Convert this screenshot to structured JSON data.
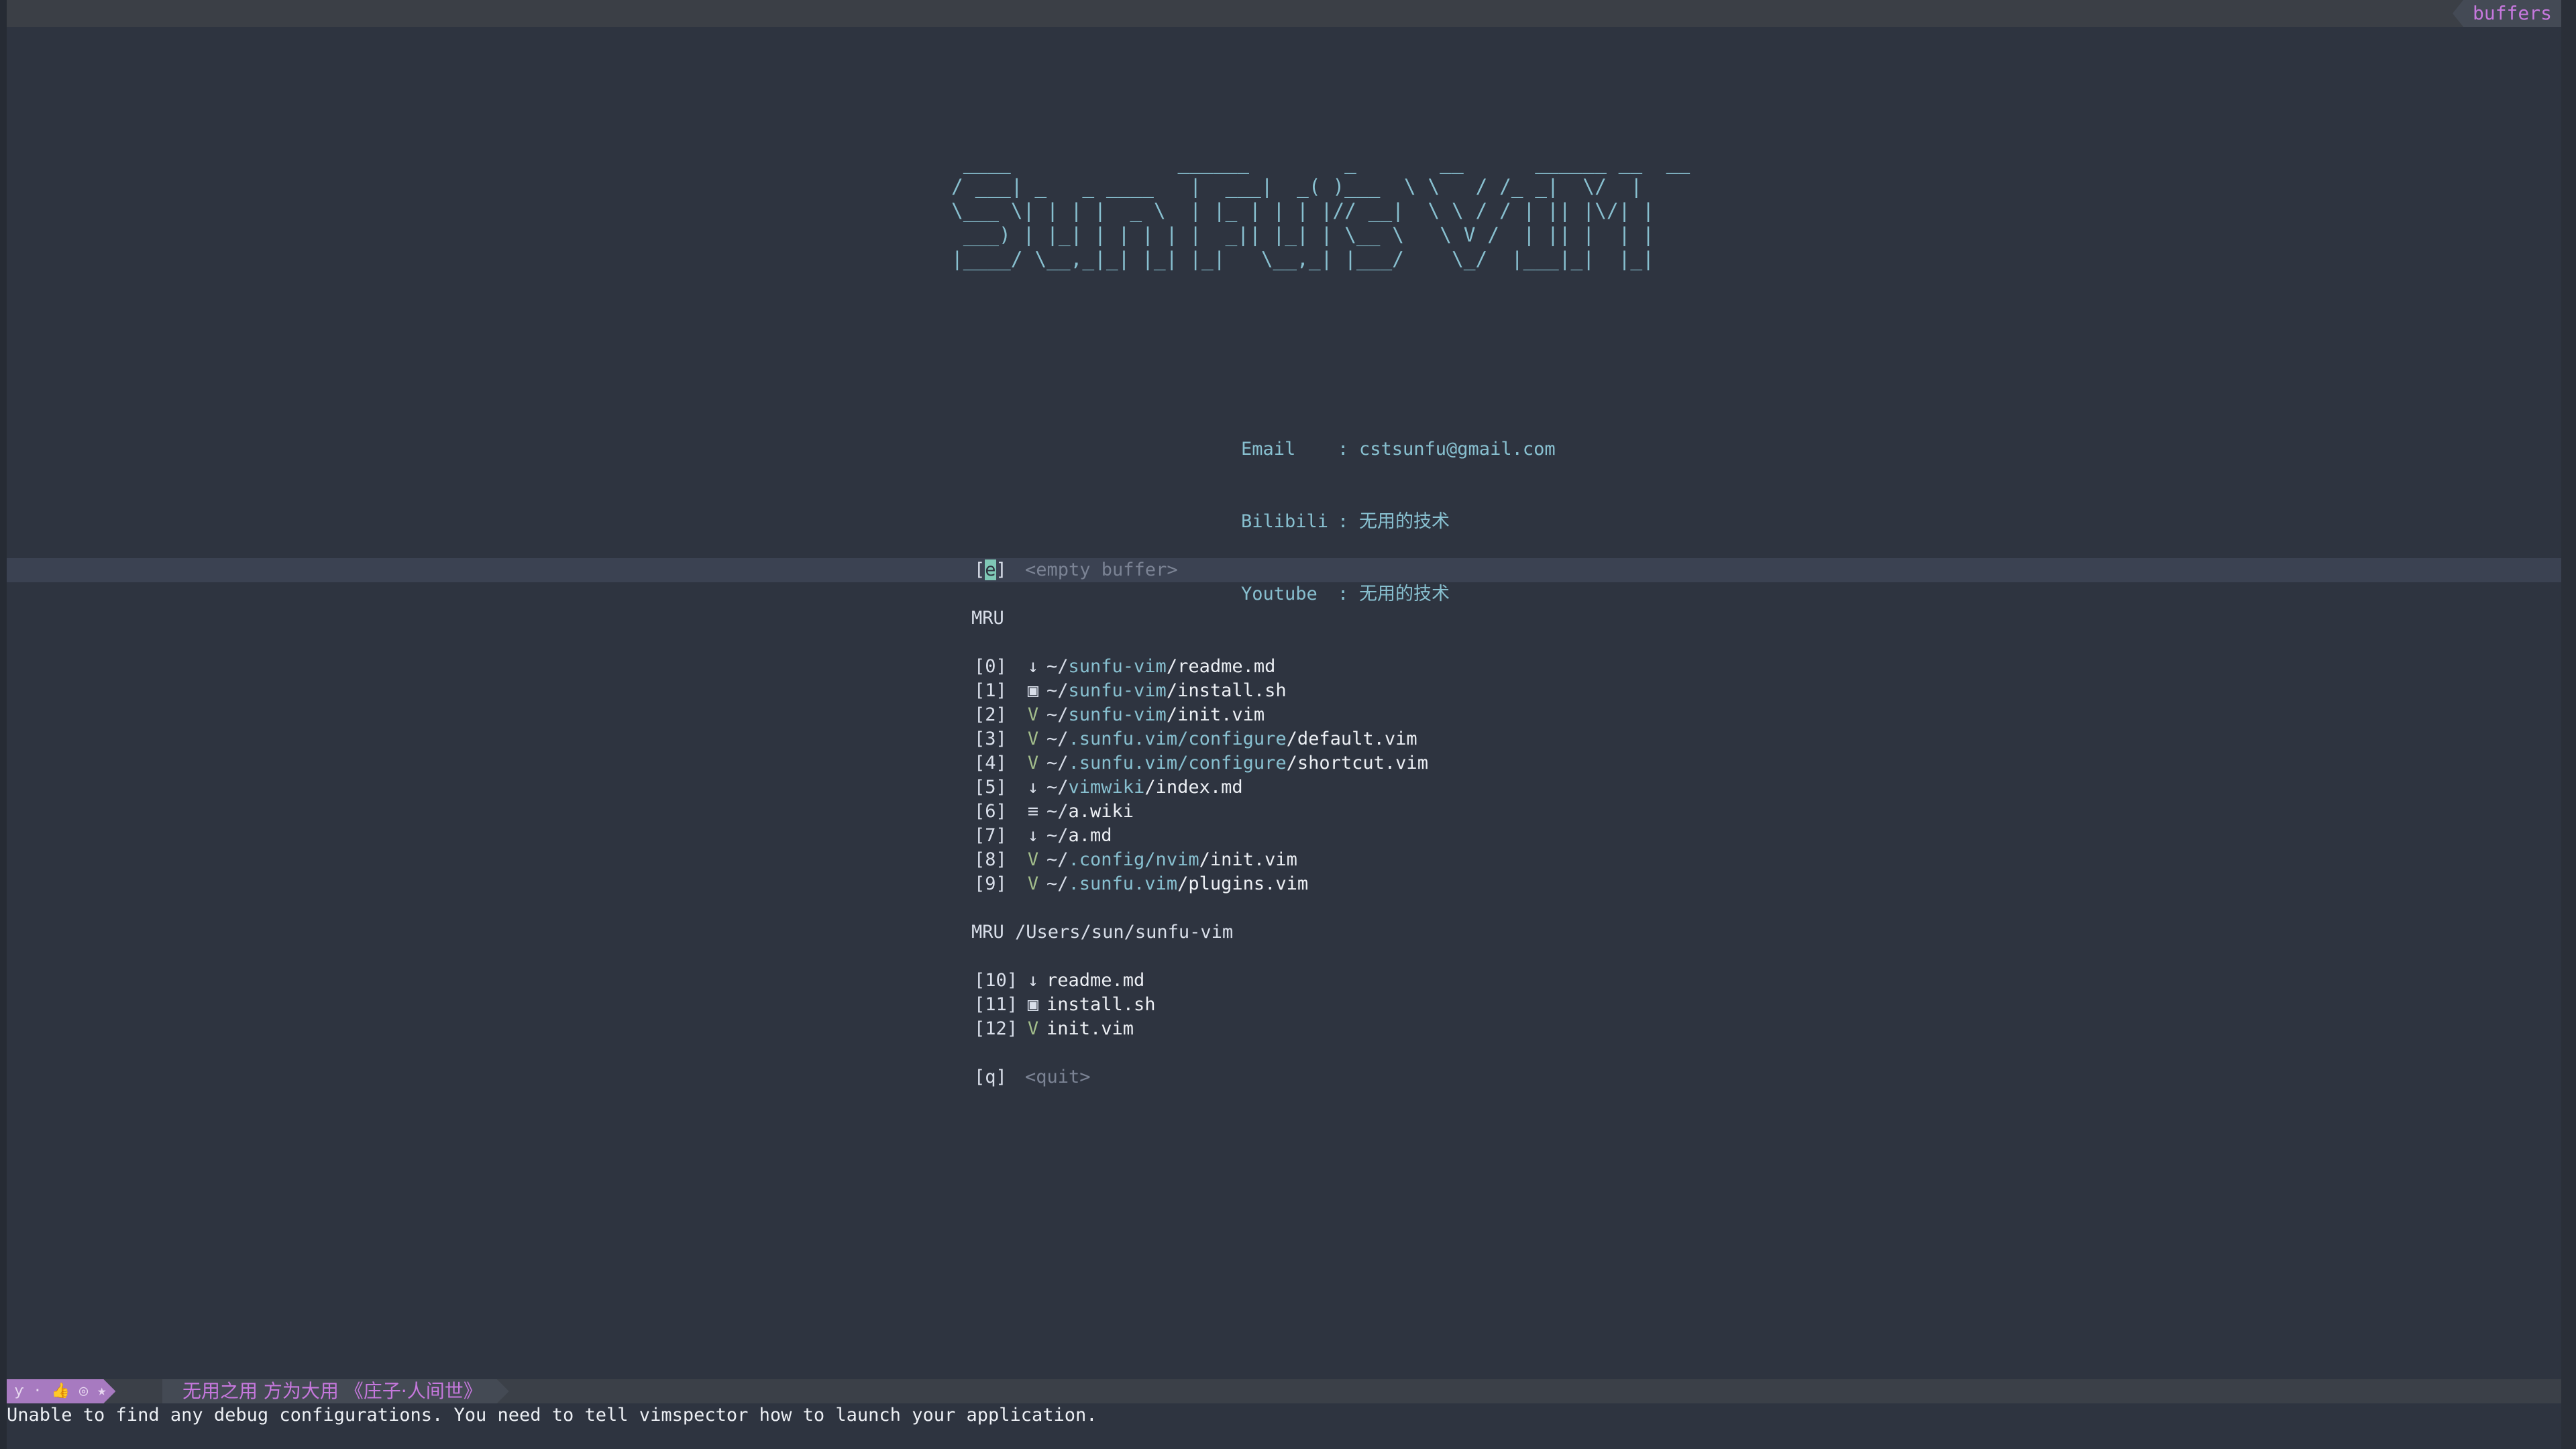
{
  "tabline": {
    "right_label": "buffers"
  },
  "banner": {
    "ascii_art": " ____              ______        _       __      ______ __  __\n/ ___| _   _ ____   |  ___|  _( )___  \\ \\   / /_ _|  \\/  |\n\\___ \\| | | |  _ \\  | |_ | | | |// __|  \\ \\ / / | || |\\/| |\n ___) | |_| | | | | |  _|| |_| | \\__ \\   \\ V /  | || |  | |\n|____/ \\__,_|_| |_| |_|   \\__,_| |___/    \\_/  |___|_|  |_|"
  },
  "contact": [
    {
      "key": "Email",
      "sep": ":",
      "value": "cstsunfu@gmail.com"
    },
    {
      "key": "Bilibili",
      "sep": ":",
      "value": "无用的技术"
    },
    {
      "key": "Youtube",
      "sep": ":",
      "value": "无用的技术"
    }
  ],
  "menu": {
    "empty_key_open": "[",
    "empty_key_letter": "e",
    "empty_key_close": "]",
    "empty_label": "<empty buffer>",
    "mru_header": "MRU",
    "mru_dir_header": "MRU /Users/sun/sunfu-vim",
    "quit_key": "[q]",
    "quit_label": "<quit>",
    "mru": [
      {
        "idx": "[0]",
        "icon": "↓",
        "icon_color": "#d8dee9",
        "tilde": "~/",
        "dir": "sunfu-vim",
        "file": "/readme.md"
      },
      {
        "idx": "[1]",
        "icon": "▣",
        "icon_color": "#d8dee9",
        "tilde": "~/",
        "dir": "sunfu-vim",
        "file": "/install.sh"
      },
      {
        "idx": "[2]",
        "icon": "V",
        "icon_color": "#a3be8c",
        "tilde": "~/",
        "dir": "sunfu-vim",
        "file": "/init.vim"
      },
      {
        "idx": "[3]",
        "icon": "V",
        "icon_color": "#a3be8c",
        "tilde": "~/",
        "dir": ".sunfu.vim/configure",
        "file": "/default.vim"
      },
      {
        "idx": "[4]",
        "icon": "V",
        "icon_color": "#a3be8c",
        "tilde": "~/",
        "dir": ".sunfu.vim/configure",
        "file": "/shortcut.vim"
      },
      {
        "idx": "[5]",
        "icon": "↓",
        "icon_color": "#d8dee9",
        "tilde": "~/",
        "dir": "vimwiki",
        "file": "/index.md"
      },
      {
        "idx": "[6]",
        "icon": "≡",
        "icon_color": "#d8dee9",
        "tilde": "~/",
        "dir": "",
        "file": "a.wiki"
      },
      {
        "idx": "[7]",
        "icon": "↓",
        "icon_color": "#d8dee9",
        "tilde": "~/",
        "dir": "",
        "file": "a.md"
      },
      {
        "idx": "[8]",
        "icon": "V",
        "icon_color": "#a3be8c",
        "tilde": "~/",
        "dir": ".config/nvim",
        "file": "/init.vim"
      },
      {
        "idx": "[9]",
        "icon": "V",
        "icon_color": "#a3be8c",
        "tilde": "~/",
        "dir": ".sunfu.vim",
        "file": "/plugins.vim"
      }
    ],
    "mru_dir": [
      {
        "idx": "[10]",
        "icon": "↓",
        "icon_color": "#d8dee9",
        "file": "readme.md"
      },
      {
        "idx": "[11]",
        "icon": "▣",
        "icon_color": "#d8dee9",
        "file": "install.sh"
      },
      {
        "idx": "[12]",
        "icon": "V",
        "icon_color": "#a3be8c",
        "file": "init.vim"
      }
    ]
  },
  "statusline": {
    "mode_icons": [
      "ƴ",
      "·",
      "👍",
      "◎",
      "★"
    ],
    "quote": "无用之用 方为大用 《庄子·人间世》"
  },
  "cmdline": {
    "message": "Unable to find any debug configurations. You need to tell vimspector how to launch your application."
  },
  "colors": {
    "background": "#2e3440",
    "accent_cyan": "#88c0d0",
    "accent_purple": "#c678dd",
    "vim_green": "#a3be8c"
  }
}
